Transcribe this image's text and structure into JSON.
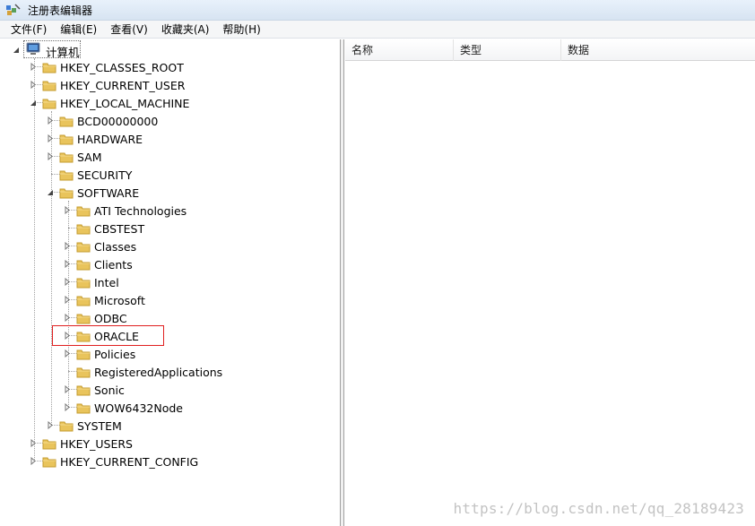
{
  "window": {
    "title": "注册表编辑器"
  },
  "menu": [
    "文件(F)",
    "编辑(E)",
    "查看(V)",
    "收藏夹(A)",
    "帮助(H)"
  ],
  "columns": [
    "名称",
    "类型",
    "数据"
  ],
  "tree": {
    "root": "计算机",
    "hives": [
      "HKEY_CLASSES_ROOT",
      "HKEY_CURRENT_USER",
      "HKEY_LOCAL_MACHINE"
    ],
    "hklm_children": [
      "BCD00000000",
      "HARDWARE",
      "SAM",
      "SECURITY",
      "SOFTWARE"
    ],
    "software_children": [
      "ATI Technologies",
      "CBSTEST",
      "Classes",
      "Clients",
      "Intel",
      "Microsoft",
      "ODBC",
      "ORACLE",
      "Policies",
      "RegisteredApplications",
      "Sonic",
      "WOW6432Node"
    ],
    "system": "SYSTEM",
    "bottom_hives": [
      "HKEY_USERS",
      "HKEY_CURRENT_CONFIG"
    ]
  },
  "watermark": "https://blog.csdn.net/qq_28189423",
  "colors": {
    "folder": "#e9c45c",
    "highlight": "#e02020"
  }
}
